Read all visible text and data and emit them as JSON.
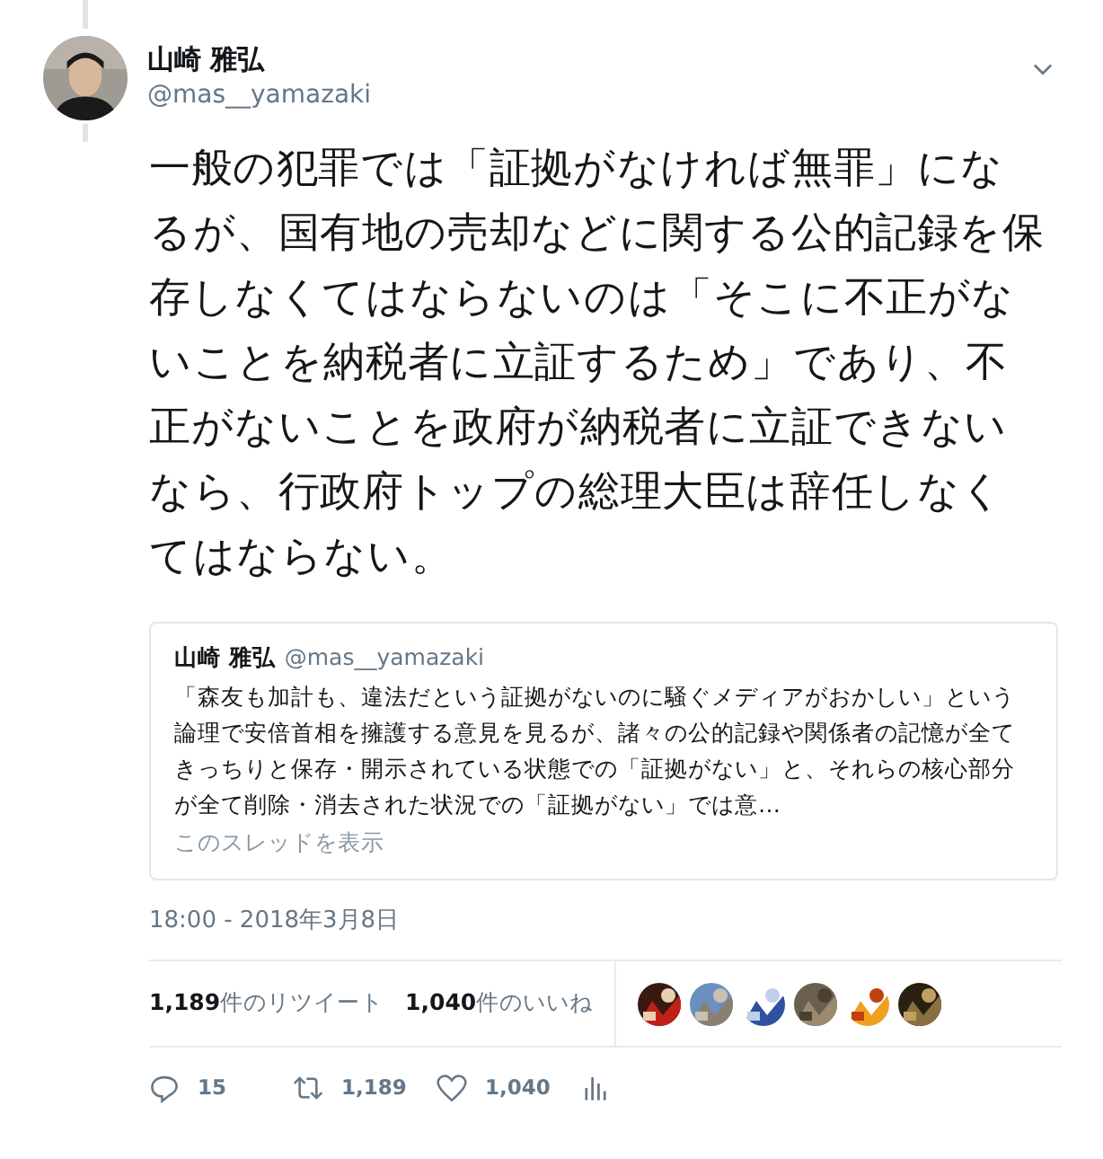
{
  "tweet": {
    "author": {
      "name": "山崎 雅弘",
      "handle": "@mas__yamazaki"
    },
    "text": "一般の犯罪では「証拠がなければ無罪」になるが、国有地の売却などに関する公的記録を保存しなくてはならないのは「そこに不正がないことを納税者に立証するため」であり、不正がないことを政府が納税者に立証できないなら、行政府トップの総理大臣は辞任しなくてはならない。",
    "quote": {
      "name": "山崎 雅弘",
      "handle": "@mas__yamazaki",
      "text": "「森友も加計も、違法だという証拠がないのに騒ぐメディアがおかしい」という論理で安倍首相を擁護する意見を見るが、諸々の公的記録や関係者の記憶が全てきっちりと保存・開示されている状態での「証拠がない」と、それらの核心部分が全て削除・消去された状況での「証拠がない」では意…",
      "link": "このスレッドを表示"
    },
    "timestamp": "18:00 - 2018年3月8日",
    "stats": [
      {
        "count": "1,189",
        "label": "件のリツイート"
      },
      {
        "count": "1,040",
        "label": "件のいいね"
      }
    ],
    "actions": [
      {
        "kind": "reply",
        "count": "15"
      },
      {
        "kind": "retweet",
        "count": "1,189"
      },
      {
        "kind": "like",
        "count": "1,040"
      },
      {
        "kind": "analytics"
      }
    ]
  }
}
